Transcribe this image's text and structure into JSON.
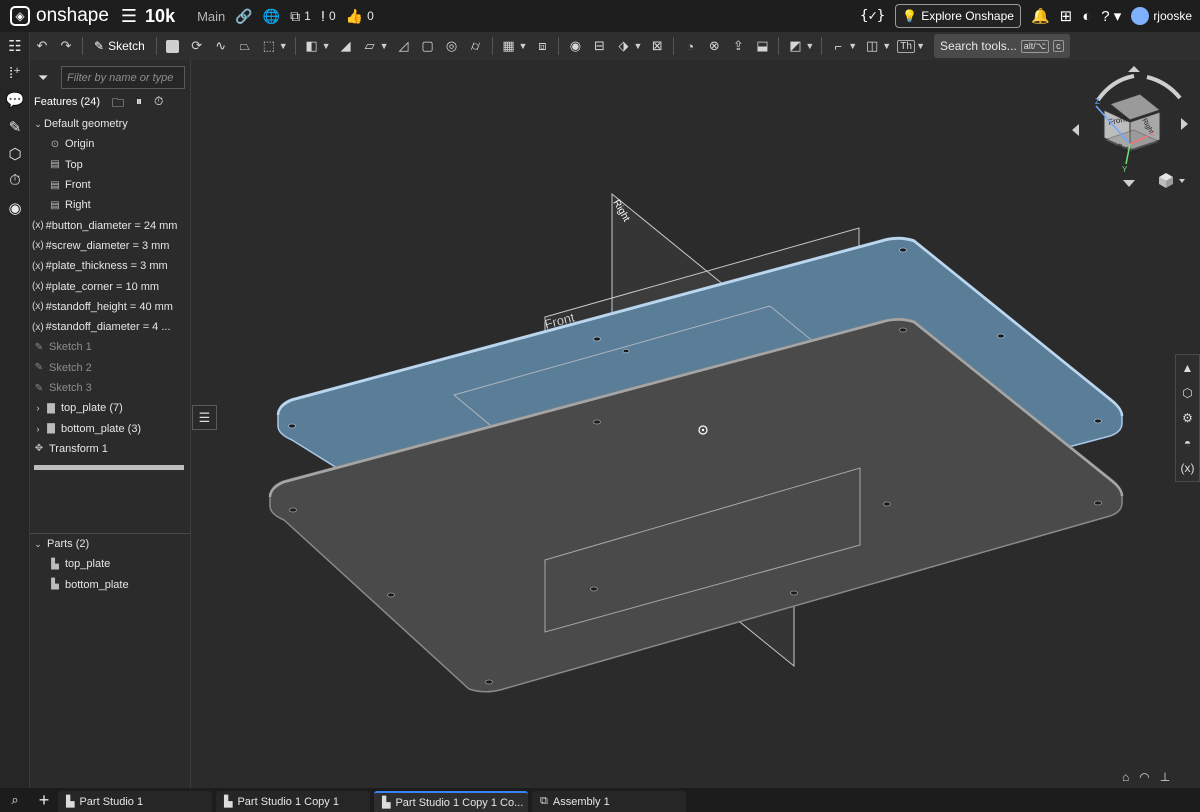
{
  "app": {
    "brand": "onshape",
    "doc_title": "10k",
    "branch": "Main",
    "versions_count": "1",
    "followers_count": "0",
    "likes_count": "0",
    "explore_label": "Explore Onshape",
    "username": "rjooske"
  },
  "toolbar": {
    "sketch_label": "Sketch",
    "text_tool_label": "Th",
    "search_label": "Search tools...",
    "search_kbd_1": "alt/⌥",
    "search_kbd_2": "c"
  },
  "filter": {
    "placeholder": "Filter by name or type"
  },
  "features": {
    "header": "Features (24)",
    "rows": [
      {
        "label": "Default geometry",
        "kind": "group"
      },
      {
        "label": "Origin",
        "kind": "origin"
      },
      {
        "label": "Top",
        "kind": "plane"
      },
      {
        "label": "Front",
        "kind": "plane"
      },
      {
        "label": "Right",
        "kind": "plane"
      },
      {
        "label": "#button_diameter = 24 mm",
        "kind": "var"
      },
      {
        "label": "#screw_diameter = 3 mm",
        "kind": "var"
      },
      {
        "label": "#plate_thickness = 3 mm",
        "kind": "var"
      },
      {
        "label": "#plate_corner = 10 mm",
        "kind": "var"
      },
      {
        "label": "#standoff_height = 40 mm",
        "kind": "var"
      },
      {
        "label": "#standoff_diameter = 4 ...",
        "kind": "var"
      },
      {
        "label": "Sketch 1",
        "kind": "sketch"
      },
      {
        "label": "Sketch 2",
        "kind": "sketch"
      },
      {
        "label": "Sketch 3",
        "kind": "sketch"
      },
      {
        "label": "top_plate (7)",
        "kind": "folder"
      },
      {
        "label": "bottom_plate (3)",
        "kind": "folder"
      },
      {
        "label": "Transform 1",
        "kind": "transform"
      }
    ]
  },
  "parts": {
    "header": "Parts (2)",
    "items": [
      "top_plate",
      "bottom_plate"
    ]
  },
  "viewport": {
    "plane_front_label": "Front",
    "plane_right_label": "Right",
    "viewcube_front": "Front",
    "viewcube_right": "Right",
    "viewcube_bottom": "Bottom",
    "axis_z": "Z",
    "axis_x": "X",
    "axis_y": "Y"
  },
  "tabs": [
    {
      "label": "Part Studio 1",
      "active": false
    },
    {
      "label": "Part Studio 1 Copy 1",
      "active": false
    },
    {
      "label": "Part Studio 1 Copy 1 Co...",
      "active": true
    },
    {
      "label": "Assembly 1",
      "active": false
    }
  ],
  "colors": {
    "top_plate": "#5a7d98",
    "bottom_plate": "#4a4a4a",
    "accent": "#3b82f6"
  }
}
